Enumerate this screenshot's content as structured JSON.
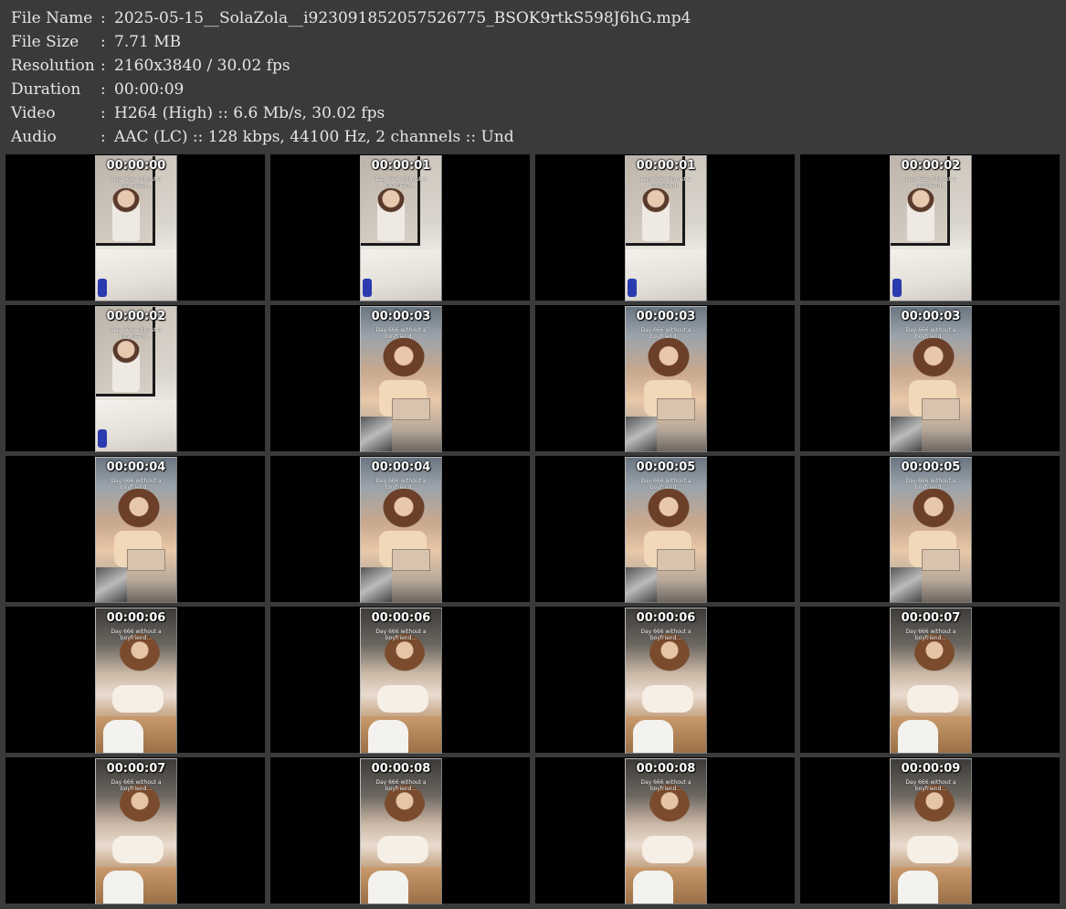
{
  "info": [
    {
      "key": "File Name",
      "value": "2025-05-15__SolaZola__i923091852057526775_BSOK9rtkS598J6hG.mp4"
    },
    {
      "key": "File Size",
      "value": "7.71 MB"
    },
    {
      "key": "Resolution",
      "value": "2160x3840 / 30.02 fps"
    },
    {
      "key": "Duration",
      "value": "00:00:09"
    },
    {
      "key": "Video",
      "value": "H264 (High) :: 6.6 Mb/s, 30.02 fps"
    },
    {
      "key": "Audio",
      "value": "AAC (LC) :: 128 kbps, 44100 Hz, 2 channels :: Und"
    }
  ],
  "separator": ":",
  "thumbnails": [
    {
      "time": "00:00:00",
      "caption": "Day 666 without a boyfriend...",
      "scene": "mirror"
    },
    {
      "time": "00:00:01",
      "caption": "Day 666 without a boyfriend...",
      "scene": "mirror"
    },
    {
      "time": "00:00:01",
      "caption": "Day 666 without a boyfriend...",
      "scene": "mirror"
    },
    {
      "time": "00:00:02",
      "caption": "Day 666 without a boyfriend...",
      "scene": "mirror"
    },
    {
      "time": "00:00:02",
      "caption": "Day 666 without a boyfriend...",
      "scene": "mirror"
    },
    {
      "time": "00:00:03",
      "caption": "Day 666 without a boyfriend...",
      "scene": "kitchen"
    },
    {
      "time": "00:00:03",
      "caption": "Day 666 without a boyfriend...",
      "scene": "kitchen"
    },
    {
      "time": "00:00:03",
      "caption": "Day 666 without a boyfriend...",
      "scene": "kitchen"
    },
    {
      "time": "00:00:04",
      "caption": "Day 666 without a boyfriend...",
      "scene": "kitchen"
    },
    {
      "time": "00:00:04",
      "caption": "Day 666 without a boyfriend...",
      "scene": "kitchen"
    },
    {
      "time": "00:00:05",
      "caption": "Day 666 without a boyfriend...",
      "scene": "kitchen"
    },
    {
      "time": "00:00:05",
      "caption": "Day 666 without a boyfriend...",
      "scene": "kitchen"
    },
    {
      "time": "00:00:06",
      "caption": "Day 666 without a boyfriend...",
      "scene": "room"
    },
    {
      "time": "00:00:06",
      "caption": "Day 666 without a boyfriend...",
      "scene": "room"
    },
    {
      "time": "00:00:06",
      "caption": "Day 666 without a boyfriend...",
      "scene": "room"
    },
    {
      "time": "00:00:07",
      "caption": "Day 666 without a boyfriend...",
      "scene": "room"
    },
    {
      "time": "00:00:07",
      "caption": "Day 666 without a boyfriend...",
      "scene": "room"
    },
    {
      "time": "00:00:08",
      "caption": "Day 666 without a boyfriend...",
      "scene": "room"
    },
    {
      "time": "00:00:08",
      "caption": "Day 666 without a boyfriend...",
      "scene": "room"
    },
    {
      "time": "00:00:09",
      "caption": "Day 666 without a boyfriend...",
      "scene": "room"
    }
  ]
}
